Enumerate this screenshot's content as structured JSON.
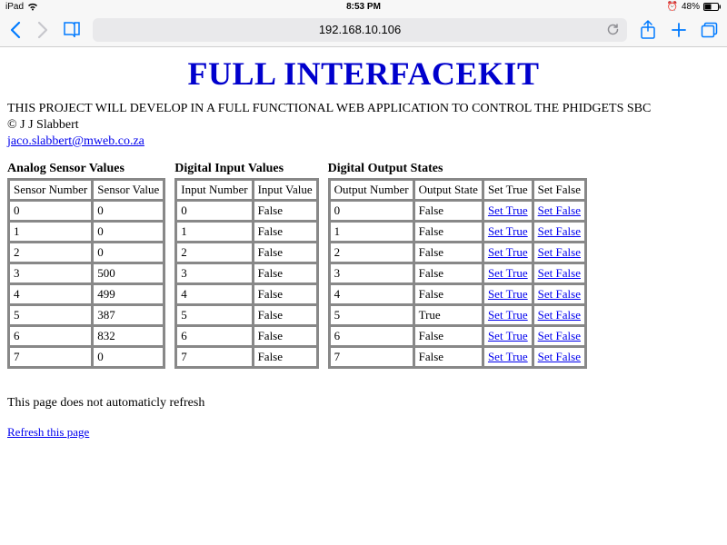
{
  "status": {
    "device": "iPad",
    "time": "8:53 PM",
    "battery": "48%",
    "alarm": "⏰"
  },
  "safari": {
    "url": "192.168.10.106"
  },
  "page": {
    "title": "FULL INTERFACEKIT",
    "subtitle": "THIS PROJECT WILL DEVELOP IN A FULL FUNCTIONAL WEB APPLICATION TO CONTROL THE PHIDGETS SBC",
    "copyright": "© J J Slabbert",
    "email": "jaco.slabbert@mweb.co.za",
    "footer_note": "This page does not automaticly refresh",
    "refresh_label": "Refresh this page"
  },
  "analog": {
    "title": "Analog Sensor Values",
    "head_num": "Sensor Number",
    "head_val": "Sensor Value",
    "rows": [
      {
        "n": "0",
        "v": "0"
      },
      {
        "n": "1",
        "v": "0"
      },
      {
        "n": "2",
        "v": "0"
      },
      {
        "n": "3",
        "v": "500"
      },
      {
        "n": "4",
        "v": "499"
      },
      {
        "n": "5",
        "v": "387"
      },
      {
        "n": "6",
        "v": "832"
      },
      {
        "n": "7",
        "v": "0"
      }
    ]
  },
  "digital_in": {
    "title": "Digital Input Values",
    "head_num": "Input Number",
    "head_val": "Input Value",
    "rows": [
      {
        "n": "0",
        "v": "False"
      },
      {
        "n": "1",
        "v": "False"
      },
      {
        "n": "2",
        "v": "False"
      },
      {
        "n": "3",
        "v": "False"
      },
      {
        "n": "4",
        "v": "False"
      },
      {
        "n": "5",
        "v": "False"
      },
      {
        "n": "6",
        "v": "False"
      },
      {
        "n": "7",
        "v": "False"
      }
    ]
  },
  "digital_out": {
    "title": "Digital Output States",
    "head_num": "Output Number",
    "head_state": "Output State",
    "head_true": "Set True",
    "head_false": "Set False",
    "link_true": "Set True",
    "link_false": "Set False",
    "rows": [
      {
        "n": "0",
        "s": "False"
      },
      {
        "n": "1",
        "s": "False"
      },
      {
        "n": "2",
        "s": "False"
      },
      {
        "n": "3",
        "s": "False"
      },
      {
        "n": "4",
        "s": "False"
      },
      {
        "n": "5",
        "s": "True"
      },
      {
        "n": "6",
        "s": "False"
      },
      {
        "n": "7",
        "s": "False"
      }
    ]
  }
}
